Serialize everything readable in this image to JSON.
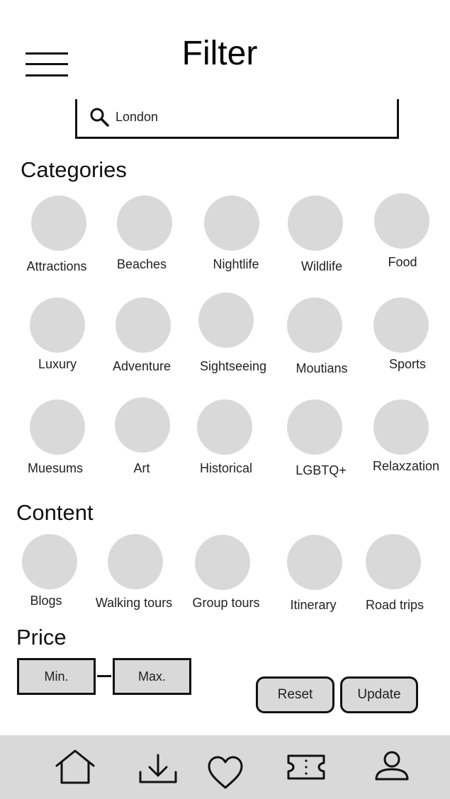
{
  "header": {
    "title": "Filter",
    "menu_icon": "hamburger-menu-icon"
  },
  "search": {
    "value": "London",
    "icon": "search-icon"
  },
  "categories": {
    "heading": "Categories",
    "items": [
      {
        "label": "Attractions"
      },
      {
        "label": "Beaches"
      },
      {
        "label": "Nightlife"
      },
      {
        "label": "Wildlife"
      },
      {
        "label": "Food"
      },
      {
        "label": "Luxury"
      },
      {
        "label": "Adventure"
      },
      {
        "label": "Sightseeing"
      },
      {
        "label": "Moutians"
      },
      {
        "label": "Sports"
      },
      {
        "label": "Muesums"
      },
      {
        "label": "Art"
      },
      {
        "label": "Historical"
      },
      {
        "label": "LGBTQ+"
      },
      {
        "label": "Relaxzation"
      }
    ]
  },
  "content": {
    "heading": "Content",
    "items": [
      {
        "label": "Blogs"
      },
      {
        "label": "Walking tours"
      },
      {
        "label": "Group tours"
      },
      {
        "label": "Itinerary"
      },
      {
        "label": "Road trips"
      }
    ]
  },
  "price": {
    "heading": "Price",
    "min_placeholder": "Min.",
    "max_placeholder": "Max."
  },
  "actions": {
    "reset_label": "Reset",
    "update_label": "Update"
  },
  "bottom_nav": {
    "items": [
      "home-icon",
      "download-icon",
      "heart-icon",
      "ticket-icon",
      "user-icon"
    ]
  },
  "colors": {
    "placeholder_fill": "#d9d9d9",
    "stroke": "#111111",
    "nav_bg": "#d9d9d9"
  }
}
